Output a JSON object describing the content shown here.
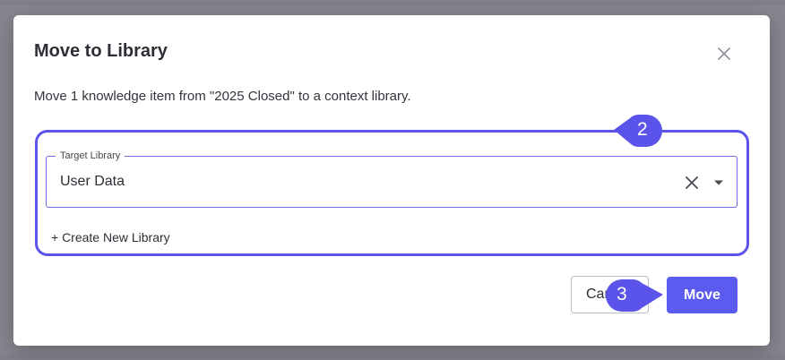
{
  "dialog": {
    "title": "Move to Library",
    "description": "Move 1 knowledge item from \"2025 Closed\" to a context library.",
    "close_icon": "close-icon"
  },
  "target_library": {
    "label": "Target Library",
    "value": "User Data",
    "clear_icon": "clear-icon",
    "caret_icon": "caret-down-icon"
  },
  "create_link": {
    "label": "+ Create New Library"
  },
  "actions": {
    "cancel_label": "Cancel",
    "move_label": "Move"
  },
  "annotations": [
    {
      "label": "2"
    },
    {
      "label": "3"
    }
  ],
  "colors": {
    "accent": "#5b54ea",
    "primary_button": "#5b5bf0",
    "backdrop": "#86868f"
  }
}
